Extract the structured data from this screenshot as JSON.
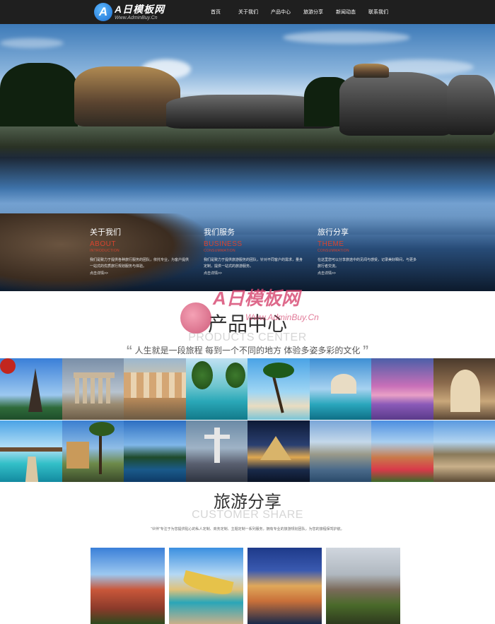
{
  "nav": {
    "logo_title": "A日模板网",
    "logo_sub": "Www.AdminBuy.Cn",
    "items": [
      {
        "label": "首页"
      },
      {
        "label": "关于我们"
      },
      {
        "label": "产品中心"
      },
      {
        "label": "旅游分享"
      },
      {
        "label": "新闻动态"
      },
      {
        "label": "联系我们"
      }
    ]
  },
  "hero": {
    "columns": [
      {
        "title": "关于我们",
        "en": "ABOUT",
        "en_sub": "INTRODUCTION",
        "body": "我们是致力于提供各种旅行服务的团队，依托专业，为客户提供一站式的优质旅行规划服务与体验。",
        "more": "点击详情>>"
      },
      {
        "title": "我们服务",
        "en": "BUSINESS",
        "en_sub": "CONSUMMATION",
        "body": "我们是致力于提供旅游服务的团队，针对不同客户的需求，量身定制，提供一站式的旅游服务。",
        "more": "点击详情>>"
      },
      {
        "title": "旅行分享",
        "en": "THEME",
        "en_sub": "CONSUMMATION",
        "body": "在这里您可以分享旅途中的见闻与感受，记录美好瞬间，与更多旅行者交流。",
        "more": "点击详情>>"
      }
    ]
  },
  "products": {
    "title": "产品中心",
    "title_en": "PRODUCTS CENTER",
    "quote": "人生就是一段旅程 每到一个不同的地方 体验多姿多彩的文化",
    "watermark_title": "A日模板网",
    "watermark_sub": "Www.AdminBuy.Cn"
  },
  "share": {
    "title": "旅游分享",
    "title_en": "CUSTOMER SHARE",
    "desc": "“伙伴”专注于为您提供贴心的私人定制、商务定制、主题定制一系列服务，拥有专业的旅游规划团队，为您的旅程保驾护航。"
  },
  "colors": {
    "nav_bg": "#1f1f1f",
    "accent_red": "#d8432e",
    "section_en_gray": "#d6d6d6"
  }
}
